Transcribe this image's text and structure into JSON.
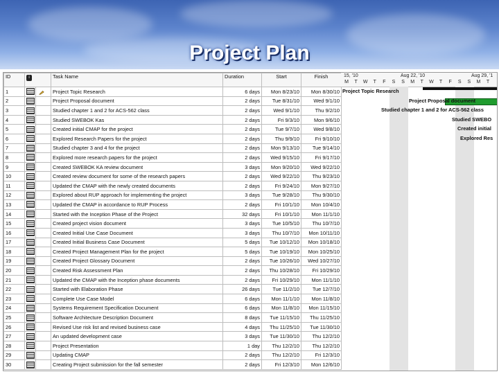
{
  "slide": {
    "title": "Project Plan"
  },
  "table": {
    "headers": {
      "id": "ID",
      "info": "i",
      "task": "Task Name",
      "duration": "Duration",
      "start": "Start",
      "finish": "Finish"
    },
    "rows": [
      {
        "id": "1",
        "task": "Project Topic Research",
        "duration": "6 days",
        "start": "Mon 8/23/10",
        "finish": "Mon 8/30/10"
      },
      {
        "id": "2",
        "task": "Project Proposal document",
        "duration": "2 days",
        "start": "Tue 8/31/10",
        "finish": "Wed 9/1/10"
      },
      {
        "id": "3",
        "task": "Studied chapter 1 and 2 for ACS-562 class",
        "duration": "2 days",
        "start": "Wed 9/1/10",
        "finish": "Thu 9/2/10"
      },
      {
        "id": "4",
        "task": "Studied SWEBOK Kas",
        "duration": "2 days",
        "start": "Fri 9/3/10",
        "finish": "Mon 9/6/10"
      },
      {
        "id": "5",
        "task": "Created initial CMAP for the project",
        "duration": "2 days",
        "start": "Tue 9/7/10",
        "finish": "Wed 9/8/10"
      },
      {
        "id": "6",
        "task": "Explored Research Papers for the project",
        "duration": "2 days",
        "start": "Thu 9/9/10",
        "finish": "Fri 9/10/10"
      },
      {
        "id": "7",
        "task": "Studied chapter 3 and 4 for the project",
        "duration": "2 days",
        "start": "Mon 9/13/10",
        "finish": "Tue 9/14/10"
      },
      {
        "id": "8",
        "task": "Explored more research papers for the project",
        "duration": "2 days",
        "start": "Wed 9/15/10",
        "finish": "Fri 9/17/10"
      },
      {
        "id": "9",
        "task": "Created SWEBOK KA review document",
        "duration": "3 days",
        "start": "Mon 9/20/10",
        "finish": "Wed 9/22/10"
      },
      {
        "id": "10",
        "task": "Created review document for some of the research papers",
        "duration": "2 days",
        "start": "Wed 9/22/10",
        "finish": "Thu 9/23/10"
      },
      {
        "id": "11",
        "task": "Updated the CMAP with the newly created documents",
        "duration": "2 days",
        "start": "Fri 9/24/10",
        "finish": "Mon 9/27/10"
      },
      {
        "id": "12",
        "task": "Explored about RUP approach for implementing the project",
        "duration": "3 days",
        "start": "Tue 9/28/10",
        "finish": "Thu 9/30/10"
      },
      {
        "id": "13",
        "task": "Updated the CMAP in accordance to RUP Process",
        "duration": "2 days",
        "start": "Fri 10/1/10",
        "finish": "Mon 10/4/10"
      },
      {
        "id": "14",
        "task": "Started with the Inception Phase of the Project",
        "duration": "32 days",
        "start": "Fri 10/1/10",
        "finish": "Mon 11/1/10"
      },
      {
        "id": "15",
        "task": "Created project vision document",
        "duration": "3 days",
        "start": "Tue 10/5/10",
        "finish": "Thu 10/7/10"
      },
      {
        "id": "16",
        "task": "Created Initial Use Case Document",
        "duration": "3 days",
        "start": "Thu 10/7/10",
        "finish": "Mon 10/11/10"
      },
      {
        "id": "17",
        "task": "Created Initial Business Case Document",
        "duration": "5 days",
        "start": "Tue 10/12/10",
        "finish": "Mon 10/18/10"
      },
      {
        "id": "18",
        "task": "Created Project Management Plan for the project",
        "duration": "5 days",
        "start": "Tue 10/19/10",
        "finish": "Mon 10/25/10"
      },
      {
        "id": "19",
        "task": "Created Project Glossary Document",
        "duration": "2 days",
        "start": "Tue 10/26/10",
        "finish": "Wed 10/27/10"
      },
      {
        "id": "20",
        "task": "Created Risk Assessment Plan",
        "duration": "2 days",
        "start": "Thu 10/28/10",
        "finish": "Fri 10/29/10"
      },
      {
        "id": "21",
        "task": "Updated the CMAP with the Inception phase documents",
        "duration": "2 days",
        "start": "Fri 10/29/10",
        "finish": "Mon 11/1/10"
      },
      {
        "id": "22",
        "task": "Started with Elaboration Phase",
        "duration": "26 days",
        "start": "Tue 11/2/10",
        "finish": "Tue 12/7/10"
      },
      {
        "id": "23",
        "task": "Complete Use Case Model",
        "duration": "6 days",
        "start": "Mon 11/1/10",
        "finish": "Mon 11/8/10"
      },
      {
        "id": "24",
        "task": "Systems Requirement Specification Document",
        "duration": "6 days",
        "start": "Mon 11/8/10",
        "finish": "Mon 11/15/10"
      },
      {
        "id": "25",
        "task": "Software Architecture Description Document",
        "duration": "8 days",
        "start": "Tue 11/15/10",
        "finish": "Thu 11/25/10"
      },
      {
        "id": "26",
        "task": "Revised Use risk list and revised business case",
        "duration": "4 days",
        "start": "Thu 11/25/10",
        "finish": "Tue 11/30/10"
      },
      {
        "id": "27",
        "task": "An updated development case",
        "duration": "3 days",
        "start": "Tue 11/30/10",
        "finish": "Thu 12/2/10"
      },
      {
        "id": "28",
        "task": "Project Presentation",
        "duration": "1 day",
        "start": "Thu 12/2/10",
        "finish": "Thu 12/2/10"
      },
      {
        "id": "29",
        "task": "Updating CMAP",
        "duration": "2 days",
        "start": "Thu 12/2/10",
        "finish": "Fri 12/3/10"
      },
      {
        "id": "30",
        "task": "Creating Project submission for the fall semester",
        "duration": "2 days",
        "start": "Fri 12/3/10",
        "finish": "Mon 12/6/10"
      }
    ]
  },
  "gantt": {
    "weeks": [
      "15, '10",
      "Aug 22, '10",
      "Aug 29, '1"
    ],
    "days": [
      "M",
      "T",
      "W",
      "T",
      "F",
      "S",
      "S",
      "M",
      "T",
      "W",
      "T",
      "F",
      "S",
      "S",
      "M",
      "T"
    ],
    "bar_color": "#1f9b2e",
    "labels": [
      {
        "text": "Project Topic Research"
      },
      {
        "text": "Project Proposal document"
      },
      {
        "text": "Studied chapter 1 and 2 for ACS-562 class"
      },
      {
        "text": "Studied SWEBO"
      },
      {
        "text": "Created initial"
      },
      {
        "text": "Explored Res"
      }
    ]
  }
}
